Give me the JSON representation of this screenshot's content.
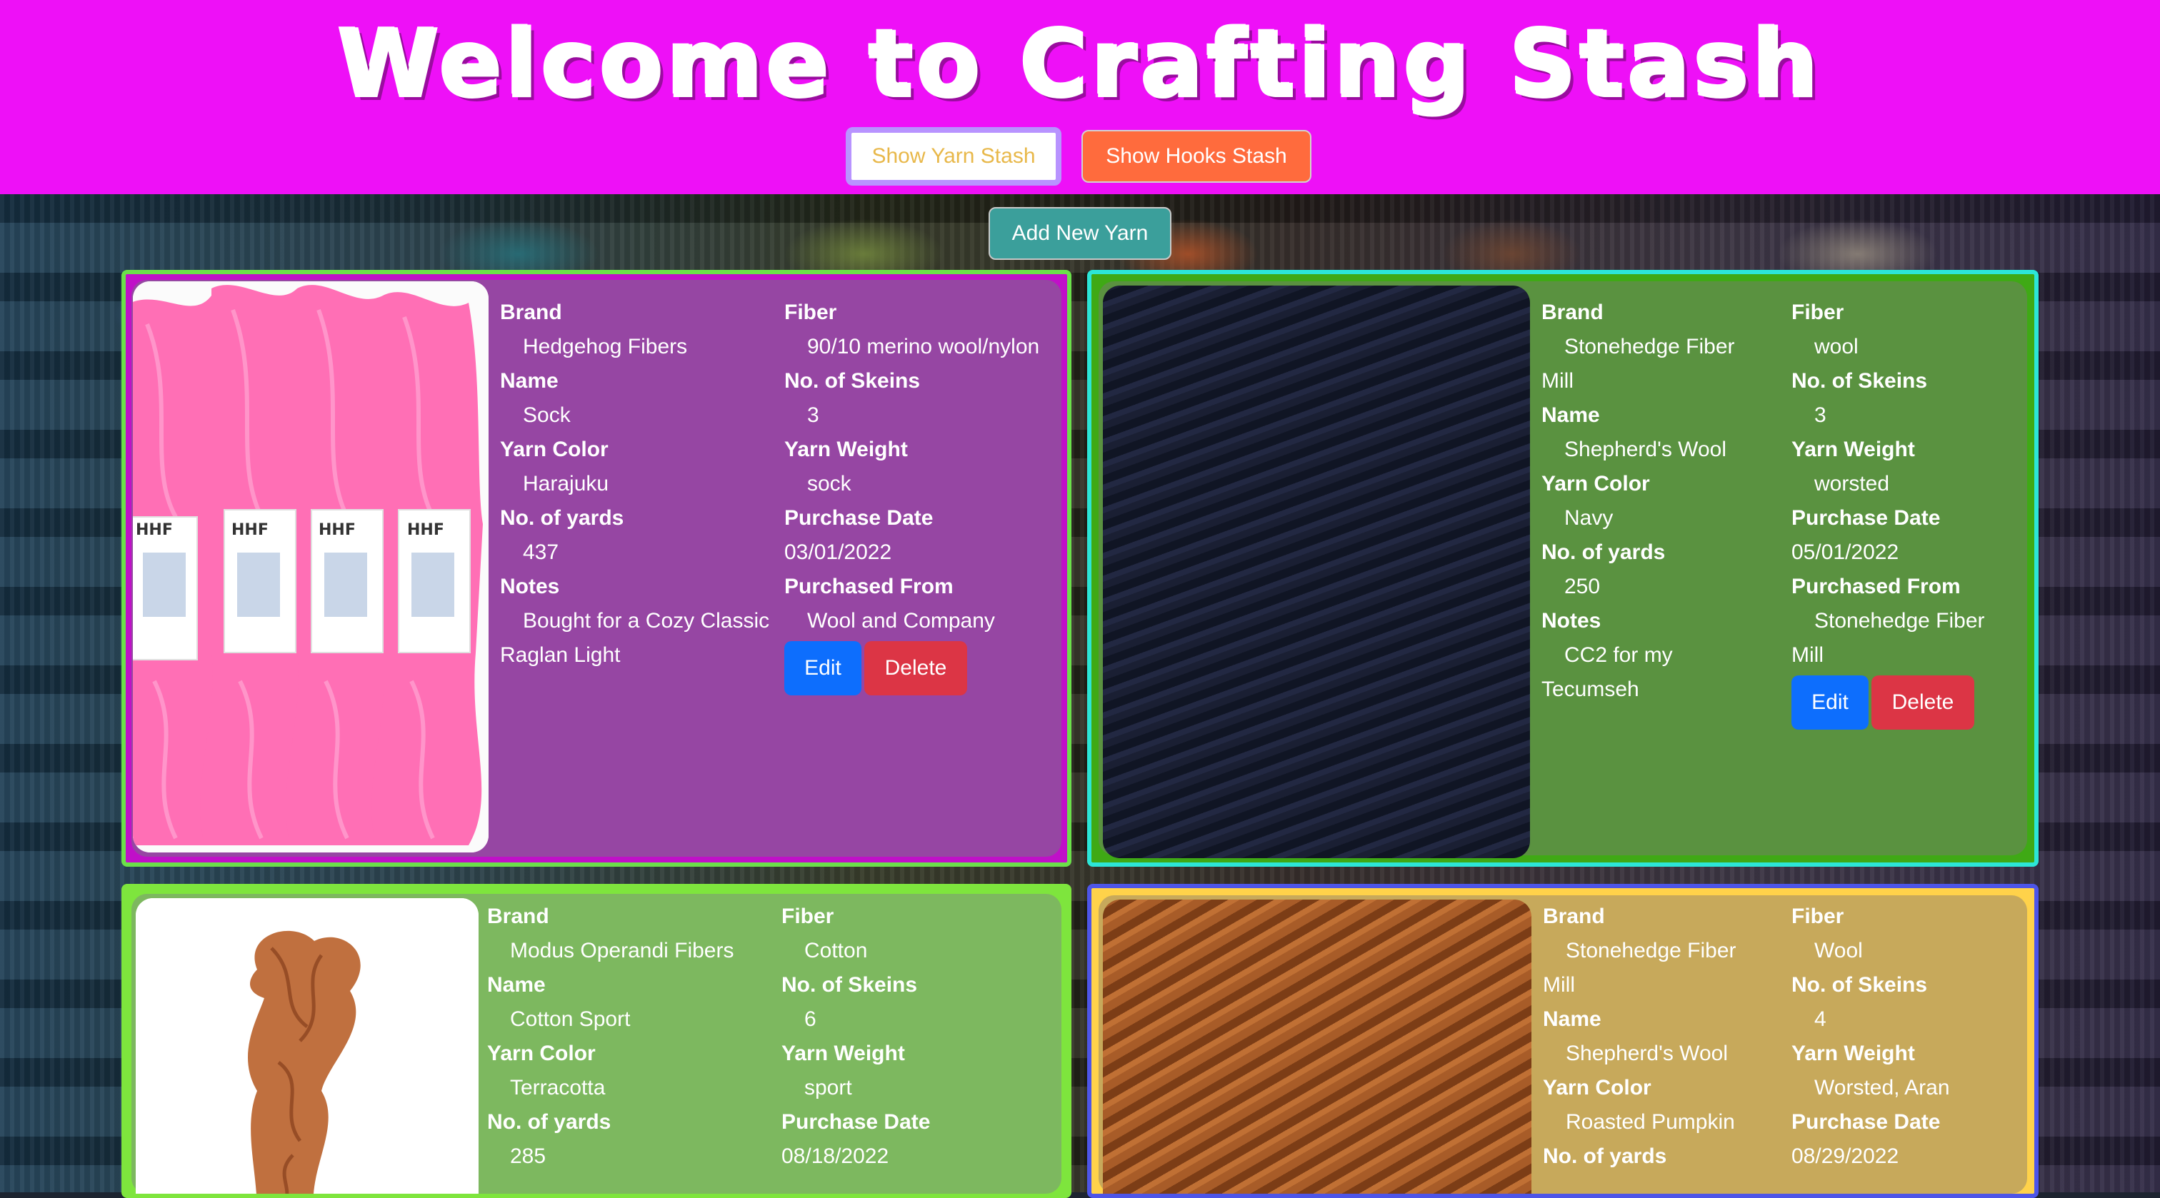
{
  "header": {
    "title": "Welcome to Crafting Stash",
    "show_yarn_label": "Show Yarn Stash",
    "show_hooks_label": "Show Hooks Stash"
  },
  "toolbar": {
    "add_yarn_label": "Add New Yarn"
  },
  "labels": {
    "brand": "Brand",
    "name": "Name",
    "yarn_color": "Yarn Color",
    "yards": "No. of yards",
    "notes": "Notes",
    "fiber": "Fiber",
    "skeins": "No. of Skeins",
    "weight": "Yarn Weight",
    "purchase_date": "Purchase Date",
    "purchased_from": "Purchased From",
    "edit": "Edit",
    "delete": "Delete"
  },
  "yarns": [
    {
      "brand": "Hedgehog Fibers",
      "name": "Sock",
      "yarn_color": "Harajuku",
      "yards": "437",
      "notes": "Bought for a Cozy Classic Raglan Light",
      "fiber": "90/10 merino wool/nylon",
      "skeins": "3",
      "weight": "sock",
      "purchase_date": "03/01/2022",
      "purchased_from": "Wool and Company",
      "photo_label": "SOCK YARN"
    },
    {
      "brand": "Stonehedge Fiber Mill",
      "name": "Shepherd's Wool",
      "yarn_color": "Navy",
      "yards": "250",
      "notes": "CC2 for my Tecumseh",
      "fiber": "wool",
      "skeins": "3",
      "weight": "worsted",
      "purchase_date": "05/01/2022",
      "purchased_from": "Stonehedge Fiber Mill"
    },
    {
      "brand": "Modus Operandi Fibers",
      "name": "Cotton Sport",
      "yarn_color": "Terracotta",
      "yards": "285",
      "fiber": "Cotton",
      "skeins": "6",
      "weight": "sport",
      "purchase_date": "08/18/2022"
    },
    {
      "brand": "Stonehedge Fiber Mill",
      "name": "Shepherd's Wool",
      "yarn_color": "Roasted Pumpkin",
      "fiber": "Wool",
      "skeins": "4",
      "weight": "Worsted, Aran",
      "purchase_date": "08/29/2022"
    }
  ],
  "colors": {
    "header_bg": "#ee10f7",
    "yarn_button_text": "#e8b84a",
    "hooks_button_bg": "#ff6b3d",
    "add_button_bg": "#3b9f9b",
    "edit_bg": "#0d6efd",
    "delete_bg": "#dc3545"
  }
}
